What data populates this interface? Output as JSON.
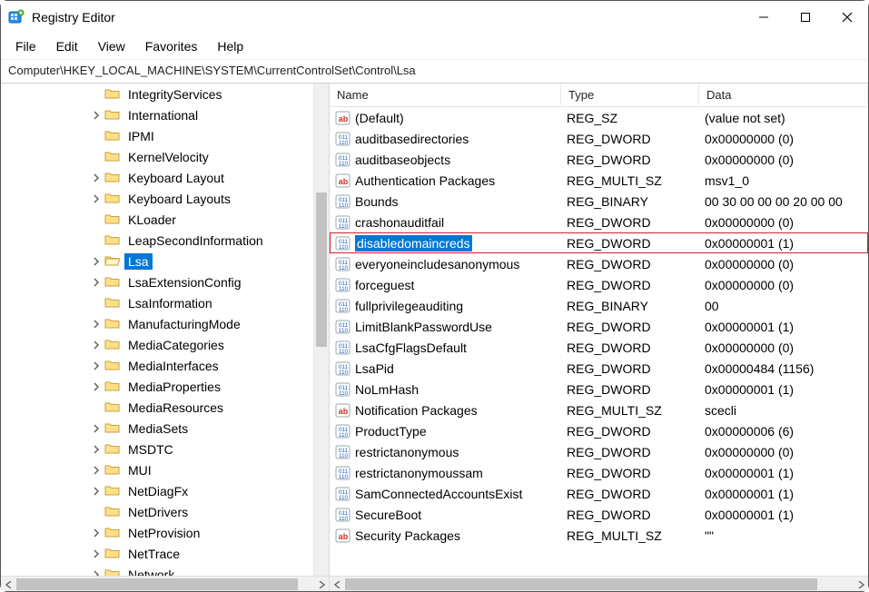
{
  "window": {
    "title": "Registry Editor"
  },
  "menu": {
    "file": "File",
    "edit": "Edit",
    "view": "View",
    "favorites": "Favorites",
    "help": "Help"
  },
  "address": "Computer\\HKEY_LOCAL_MACHINE\\SYSTEM\\CurrentControlSet\\Control\\Lsa",
  "columns": {
    "name": "Name",
    "type": "Type",
    "data": "Data"
  },
  "tree": [
    {
      "label": "IntegrityServices",
      "expandable": false,
      "indent": 5
    },
    {
      "label": "International",
      "expandable": true,
      "indent": 5
    },
    {
      "label": "IPMI",
      "expandable": false,
      "indent": 5
    },
    {
      "label": "KernelVelocity",
      "expandable": false,
      "indent": 5
    },
    {
      "label": "Keyboard Layout",
      "expandable": true,
      "indent": 5
    },
    {
      "label": "Keyboard Layouts",
      "expandable": true,
      "indent": 5
    },
    {
      "label": "KLoader",
      "expandable": false,
      "indent": 5
    },
    {
      "label": "LeapSecondInformation",
      "expandable": false,
      "indent": 5
    },
    {
      "label": "Lsa",
      "expandable": true,
      "indent": 5,
      "selected": true,
      "open": true
    },
    {
      "label": "LsaExtensionConfig",
      "expandable": true,
      "indent": 5
    },
    {
      "label": "LsaInformation",
      "expandable": false,
      "indent": 5
    },
    {
      "label": "ManufacturingMode",
      "expandable": true,
      "indent": 5
    },
    {
      "label": "MediaCategories",
      "expandable": true,
      "indent": 5
    },
    {
      "label": "MediaInterfaces",
      "expandable": true,
      "indent": 5
    },
    {
      "label": "MediaProperties",
      "expandable": true,
      "indent": 5
    },
    {
      "label": "MediaResources",
      "expandable": false,
      "indent": 5
    },
    {
      "label": "MediaSets",
      "expandable": true,
      "indent": 5
    },
    {
      "label": "MSDTC",
      "expandable": true,
      "indent": 5
    },
    {
      "label": "MUI",
      "expandable": true,
      "indent": 5
    },
    {
      "label": "NetDiagFx",
      "expandable": true,
      "indent": 5
    },
    {
      "label": "NetDrivers",
      "expandable": false,
      "indent": 5
    },
    {
      "label": "NetProvision",
      "expandable": true,
      "indent": 5
    },
    {
      "label": "NetTrace",
      "expandable": true,
      "indent": 5
    },
    {
      "label": "Network",
      "expandable": true,
      "indent": 5
    }
  ],
  "values": [
    {
      "name": "(Default)",
      "type": "REG_SZ",
      "data": "(value not set)",
      "icon": "sz"
    },
    {
      "name": "auditbasedirectories",
      "type": "REG_DWORD",
      "data": "0x00000000 (0)",
      "icon": "bin"
    },
    {
      "name": "auditbaseobjects",
      "type": "REG_DWORD",
      "data": "0x00000000 (0)",
      "icon": "bin"
    },
    {
      "name": "Authentication Packages",
      "type": "REG_MULTI_SZ",
      "data": "msv1_0",
      "icon": "sz"
    },
    {
      "name": "Bounds",
      "type": "REG_BINARY",
      "data": "00 30 00 00 00 20 00 00",
      "icon": "bin"
    },
    {
      "name": "crashonauditfail",
      "type": "REG_DWORD",
      "data": "0x00000000 (0)",
      "icon": "bin"
    },
    {
      "name": "disabledomaincreds",
      "type": "REG_DWORD",
      "data": "0x00000001 (1)",
      "icon": "bin",
      "highlighted": true
    },
    {
      "name": "everyoneincludesanonymous",
      "type": "REG_DWORD",
      "data": "0x00000000 (0)",
      "icon": "bin"
    },
    {
      "name": "forceguest",
      "type": "REG_DWORD",
      "data": "0x00000000 (0)",
      "icon": "bin"
    },
    {
      "name": "fullprivilegeauditing",
      "type": "REG_BINARY",
      "data": "00",
      "icon": "bin"
    },
    {
      "name": "LimitBlankPasswordUse",
      "type": "REG_DWORD",
      "data": "0x00000001 (1)",
      "icon": "bin"
    },
    {
      "name": "LsaCfgFlagsDefault",
      "type": "REG_DWORD",
      "data": "0x00000000 (0)",
      "icon": "bin"
    },
    {
      "name": "LsaPid",
      "type": "REG_DWORD",
      "data": "0x00000484 (1156)",
      "icon": "bin"
    },
    {
      "name": "NoLmHash",
      "type": "REG_DWORD",
      "data": "0x00000001 (1)",
      "icon": "bin"
    },
    {
      "name": "Notification Packages",
      "type": "REG_MULTI_SZ",
      "data": "scecli",
      "icon": "sz"
    },
    {
      "name": "ProductType",
      "type": "REG_DWORD",
      "data": "0x00000006 (6)",
      "icon": "bin"
    },
    {
      "name": "restrictanonymous",
      "type": "REG_DWORD",
      "data": "0x00000000 (0)",
      "icon": "bin"
    },
    {
      "name": "restrictanonymoussam",
      "type": "REG_DWORD",
      "data": "0x00000001 (1)",
      "icon": "bin"
    },
    {
      "name": "SamConnectedAccountsExist",
      "type": "REG_DWORD",
      "data": "0x00000001 (1)",
      "icon": "bin"
    },
    {
      "name": "SecureBoot",
      "type": "REG_DWORD",
      "data": "0x00000001 (1)",
      "icon": "bin"
    },
    {
      "name": "Security Packages",
      "type": "REG_MULTI_SZ",
      "data": "\"\"",
      "icon": "sz"
    }
  ]
}
